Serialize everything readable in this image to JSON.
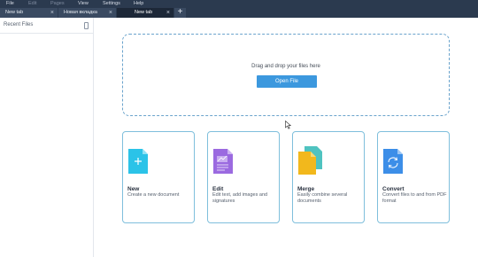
{
  "menu": [
    "File",
    "Edit",
    "Pages",
    "View",
    "Settings",
    "Help"
  ],
  "tabs": [
    {
      "label": "New tab"
    },
    {
      "label": "Новая вкладка"
    },
    {
      "label": "New tab"
    }
  ],
  "newtab_symbol": "+",
  "close_symbol": "×",
  "sidebar": {
    "title": "Recent Files"
  },
  "dropzone": {
    "text": "Drag and drop your files here",
    "button": "Open File"
  },
  "cards": [
    {
      "title": "New",
      "desc": "Create a new document",
      "color": "#2bc3e8"
    },
    {
      "title": "Edit",
      "desc": "Edit text, add images and signatures",
      "color": "#9b6ae0"
    },
    {
      "title": "Merge",
      "desc": "Easily combine several documents",
      "color": "#f2b81c"
    },
    {
      "title": "Convert",
      "desc": "Convert files to and from PDF format",
      "color": "#3c8ee8"
    }
  ]
}
